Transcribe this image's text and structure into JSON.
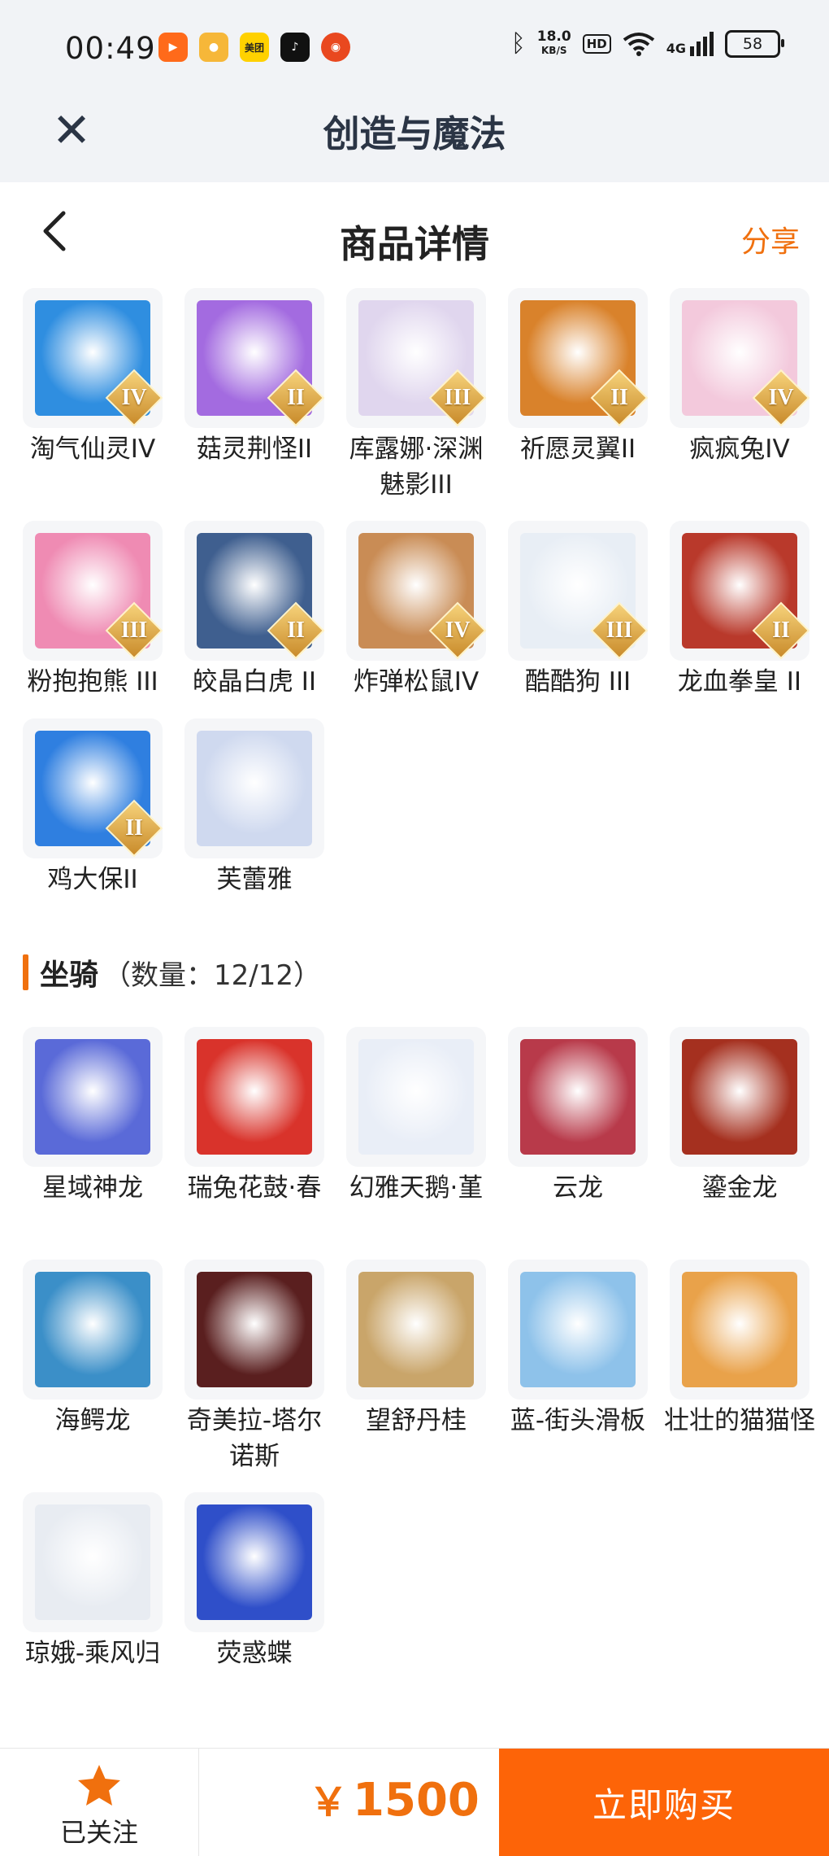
{
  "status_bar": {
    "time": "00:49",
    "net_speed_value": "18.0",
    "net_speed_unit": "KB/S",
    "hd": "HD",
    "network": "4G",
    "battery": "58",
    "app_icons": [
      "kuaishou-icon",
      "bilibili-icon",
      "meituan-icon",
      "douyin-icon",
      "weibo-icon"
    ],
    "meituan_label": "美团"
  },
  "app_header": {
    "title": "创造与魔法"
  },
  "nav": {
    "title": "商品详情",
    "share": "分享"
  },
  "pets": {
    "items": [
      {
        "label": "淘气仙灵IV",
        "level": "IV",
        "color": "#2f8ee0"
      },
      {
        "label": "菇灵荆怪II",
        "level": "II",
        "color": "#a36be0"
      },
      {
        "label": "库露娜·深渊魅影III",
        "level": "III",
        "color": "#e0d6ee"
      },
      {
        "label": "祈愿灵翼II",
        "level": "II",
        "color": "#d9822b"
      },
      {
        "label": "疯疯兔IV",
        "level": "IV",
        "color": "#f3c9dc"
      },
      {
        "label": "粉抱抱熊 III",
        "level": "III",
        "color": "#ef8bb3"
      },
      {
        "label": "皎晶白虎 II",
        "level": "II",
        "color": "#3f5f8f"
      },
      {
        "label": "炸弹松鼠IV",
        "level": "IV",
        "color": "#c98c55"
      },
      {
        "label": "酷酷狗 III",
        "level": "III",
        "color": "#e8eef5"
      },
      {
        "label": "龙血拳皇 II",
        "level": "II",
        "color": "#b9392b"
      },
      {
        "label": "鸡大保II",
        "level": "II",
        "color": "#2f7fe0"
      },
      {
        "label": "芙蕾雅",
        "level": "",
        "color": "#cfd9ef"
      }
    ]
  },
  "mounts": {
    "title": "坐骑",
    "count": "（数量：12/12）",
    "items": [
      {
        "label": "星域神龙",
        "color": "#5a6ad8"
      },
      {
        "label": "瑞兔花鼓·春",
        "color": "#d9332b"
      },
      {
        "label": "幻雅天鹅·堇",
        "color": "#e9eef7"
      },
      {
        "label": "云龙",
        "color": "#b83a4a"
      },
      {
        "label": "鎏金龙",
        "color": "#a5301f"
      },
      {
        "label": "海鳄龙",
        "color": "#3b8fc8"
      },
      {
        "label": "奇美拉-塔尔诺斯",
        "color": "#5a1f1f"
      },
      {
        "label": "望舒丹桂",
        "color": "#c9a56a"
      },
      {
        "label": "蓝-街头滑板",
        "color": "#8ec2ea"
      },
      {
        "label": "壮壮的猫猫怪",
        "color": "#e9a24a"
      },
      {
        "label": "琼娥-乘风归",
        "color": "#e8ecf2"
      },
      {
        "label": "荧惑蝶",
        "color": "#2f4fc9"
      }
    ]
  },
  "bottom_bar": {
    "follow": "已关注",
    "currency": "￥",
    "price": "1500",
    "buy": "立即购买"
  },
  "colors": {
    "accent": "#f0700e",
    "buy_button": "#fd6408",
    "header_bg": "#f1f3f6"
  }
}
